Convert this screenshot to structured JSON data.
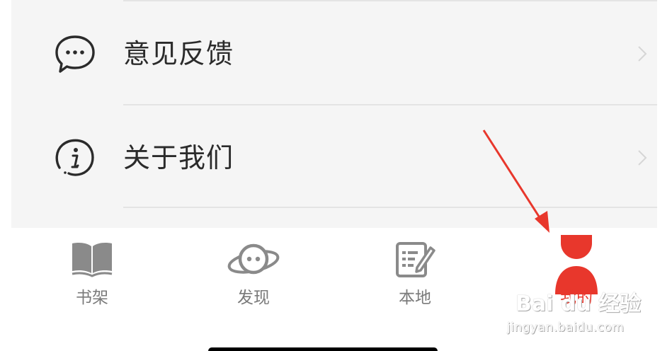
{
  "menu": {
    "items": [
      {
        "label": "意见反馈",
        "icon": "chat-bubble-icon"
      },
      {
        "label": "关于我们",
        "icon": "info-circle-icon"
      }
    ]
  },
  "tab_bar": {
    "active_tab": "我的",
    "active_color": "#e8372c",
    "inactive_color": "#7a7a7a",
    "tabs": [
      {
        "label": "书架",
        "icon": "book-icon"
      },
      {
        "label": "发现",
        "icon": "planet-face-icon"
      },
      {
        "label": "本地",
        "icon": "note-edit-icon"
      },
      {
        "label": "我的",
        "icon": "user-icon"
      }
    ]
  },
  "watermark": {
    "brand": "Bai du 经验",
    "url": "jingyan.baidu.com"
  },
  "annotation": {
    "color": "#e8372c",
    "icon": "red-arrow-pointer"
  }
}
